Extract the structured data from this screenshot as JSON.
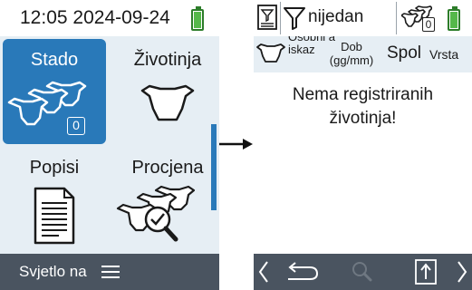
{
  "status": {
    "time": "12:05",
    "date": "2024-09-24",
    "battery_level": 1.0,
    "battery_color": "#55b84a"
  },
  "tiles": {
    "stado": {
      "label": "Stado",
      "count": "0",
      "selected": true
    },
    "zivotinja": {
      "label": "Životinja"
    },
    "popisi": {
      "label": "Popisi"
    },
    "procjena": {
      "label": "Procjena"
    }
  },
  "left_bottom": {
    "light_label": "Svjetlo na"
  },
  "right_header": {
    "filter_label": "nijedan",
    "herd_count": "0"
  },
  "columns": {
    "id": "Osobni a iskaz",
    "age": "Dob (gg/mm)",
    "sex": "Spol",
    "type": "Vrsta"
  },
  "empty": {
    "line1": "Nema registriranih",
    "line2": "životinja!"
  },
  "colors": {
    "accent": "#2979b9",
    "panel": "#e6eef4",
    "bar": "#4a5460"
  },
  "icons": [
    "battery-icon",
    "herd-icon",
    "cow-head-icon",
    "document-icon",
    "herd-search-icon",
    "menu-icon",
    "arrow-right-icon",
    "filter-document-icon",
    "funnel-icon",
    "chevron-left-icon",
    "back-icon",
    "search-icon",
    "upload-icon",
    "chevron-right-icon"
  ]
}
